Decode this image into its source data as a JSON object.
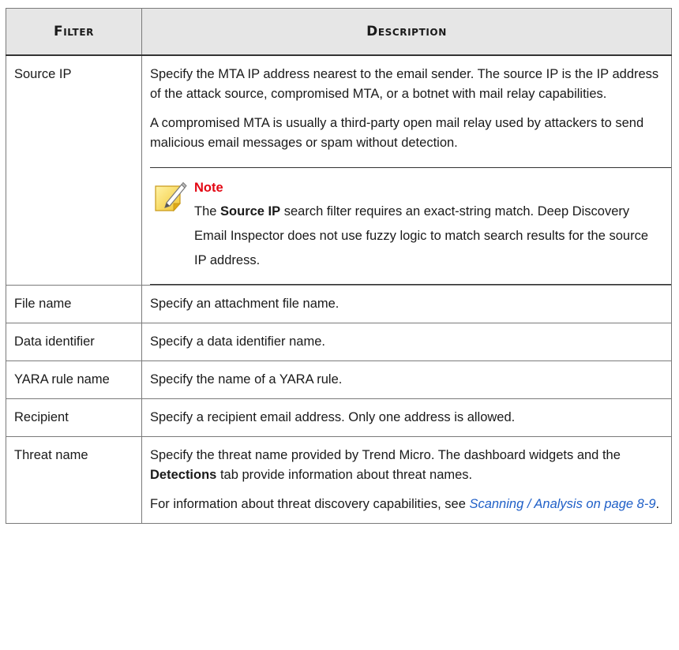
{
  "table": {
    "headers": {
      "filter": "Filter",
      "description": "Description"
    },
    "rows": [
      {
        "name": "Source IP",
        "p1": "Specify the MTA IP address nearest to the email sender. The source IP is the IP address of the attack source, compromised MTA, or a botnet with mail relay capabilities.",
        "p2": "A compromised MTA is usually a third-party open mail relay used by attackers to send malicious email messages or spam without detection.",
        "note": {
          "title": "Note",
          "text_pre": "The ",
          "text_bold": "Source IP",
          "text_post": " search filter requires an exact-string match. Deep Discovery Email Inspector does not use fuzzy logic to match search results for the source IP address.",
          "icon": "note-pencil-icon"
        }
      },
      {
        "name": "File name",
        "desc": "Specify an attachment file name."
      },
      {
        "name": "Data identifier",
        "desc": "Specify a data identifier name."
      },
      {
        "name": "YARA rule name",
        "desc": "Specify the name of a YARA rule."
      },
      {
        "name": "Recipient",
        "desc": "Specify a recipient email address. Only one address is allowed."
      },
      {
        "name": "Threat name",
        "p1_pre": "Specify the threat name provided by Trend Micro. The dashboard widgets and the ",
        "p1_bold": "Detections",
        "p1_post": " tab provide information about threat names.",
        "p2_pre": "For information about threat discovery capabilities, see ",
        "p2_link": "Scanning / Analysis on page 8-9",
        "p2_post": "."
      }
    ]
  },
  "colors": {
    "header_bg": "#e6e6e6",
    "note_title": "#e30613",
    "link": "#1f5fc7",
    "border": "#7a7a7a"
  }
}
